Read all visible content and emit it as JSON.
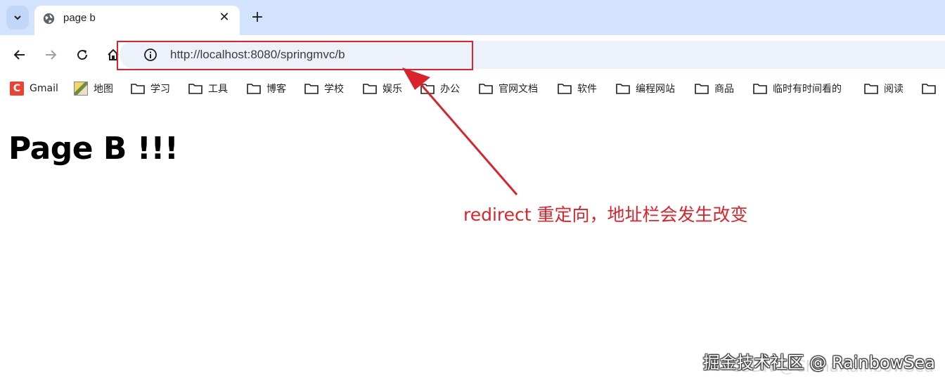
{
  "tab": {
    "title": "page b",
    "close": "✕"
  },
  "new_tab": "+",
  "omnibox": {
    "url": "http://localhost:8080/springmvc/b"
  },
  "bookmarks": {
    "gmail": "Gmail",
    "map": "地图",
    "folders": [
      "学习",
      "工具",
      "博客",
      "学校",
      "娱乐",
      "办公",
      "官网文档",
      "软件",
      "编程网站",
      "商品",
      "临时有时间看的",
      "阅读"
    ]
  },
  "page": {
    "heading": "Page B !!!"
  },
  "annotation": "redirect 重定向，地址栏会发生改变",
  "watermark": {
    "main": "掘金技术社区 @ RainbowSea",
    "faint": "CSDN @ChinaRainbowSea"
  },
  "colors": {
    "annotation_red": "#d9242b",
    "tab_strip": "#d3e3fd",
    "omnibox_bg": "#edf2fa",
    "gmail_red": "#ea4335"
  }
}
